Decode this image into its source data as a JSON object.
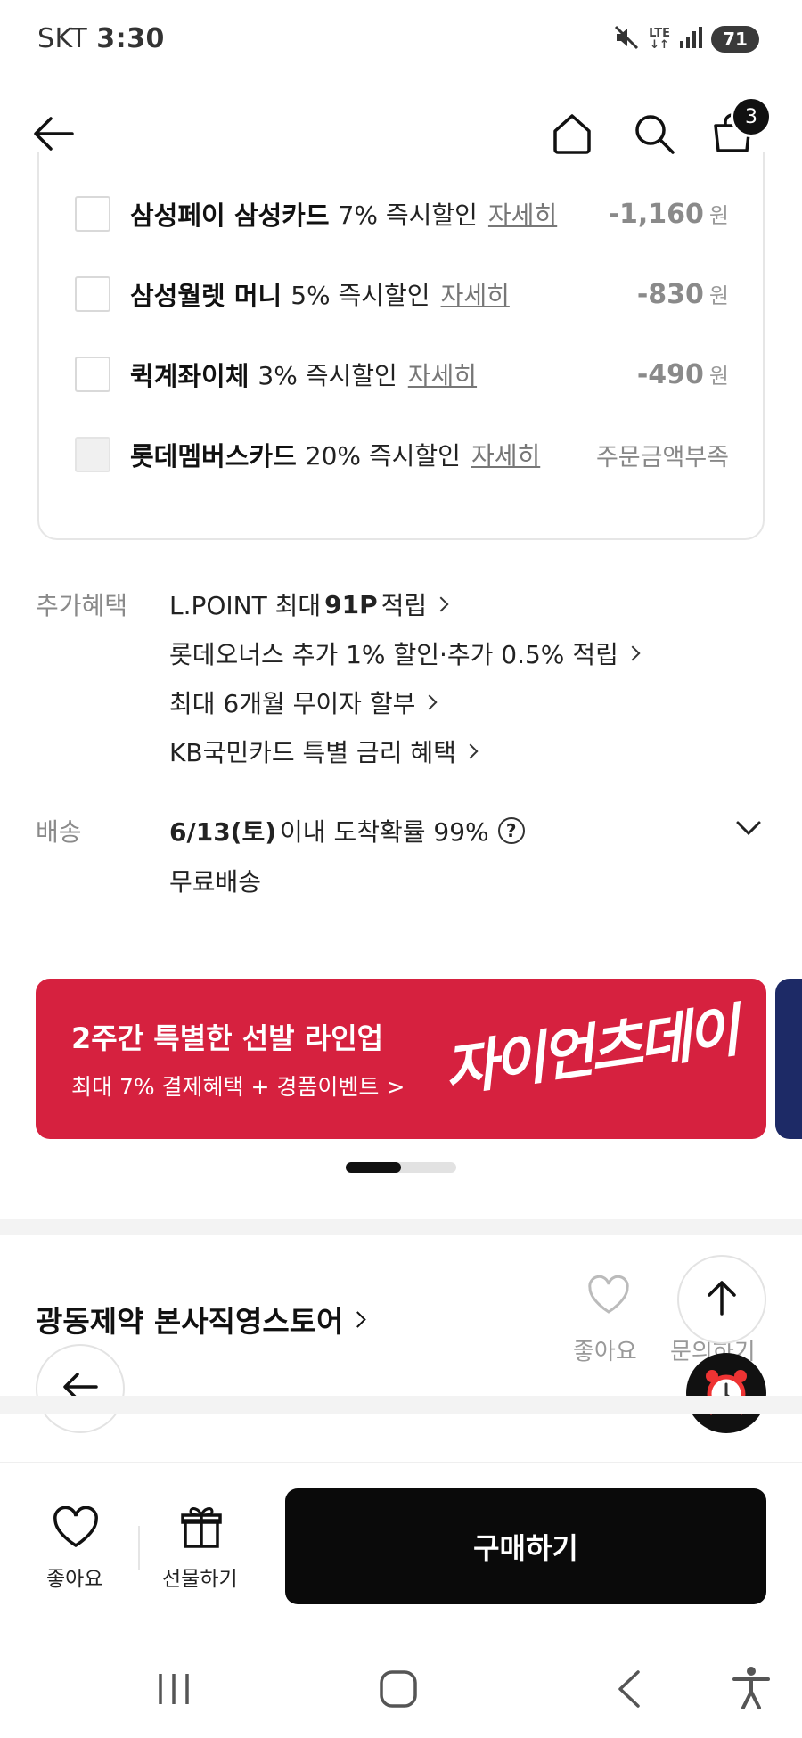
{
  "status_bar": {
    "carrier": "SKT",
    "time": "3:30",
    "network": "LTE",
    "battery": "71"
  },
  "header": {
    "cart_count": "3"
  },
  "payment_options": [
    {
      "name": "삼성페이 삼성카드",
      "desc": "7% 즉시할인",
      "link": "자세히",
      "amount": "-1,160",
      "unit": "원",
      "enabled": true
    },
    {
      "name": "삼성월렛 머니",
      "desc": "5% 즉시할인",
      "link": "자세히",
      "amount": "-830",
      "unit": "원",
      "enabled": true
    },
    {
      "name": "퀵계좌이체",
      "desc": "3% 즉시할인",
      "link": "자세히",
      "amount": "-490",
      "unit": "원",
      "enabled": true
    },
    {
      "name": "롯데멤버스카드",
      "desc": "20% 즉시할인",
      "link": "자세히",
      "note": "주문금액부족",
      "enabled": false
    }
  ],
  "benefits": {
    "label": "추가혜택",
    "items": [
      {
        "pre": "L.POINT 최대",
        "bold": "91P",
        "post": "적립"
      },
      {
        "pre": "롯데오너스 추가 1% 할인·추가 0.5% 적립",
        "bold": "",
        "post": ""
      },
      {
        "pre": "최대 6개월 무이자 할부",
        "bold": "",
        "post": ""
      },
      {
        "pre": "KB국민카드 특별 금리 혜택",
        "bold": "",
        "post": ""
      }
    ]
  },
  "delivery": {
    "label": "배송",
    "date": "6/13(토)",
    "text": "이내 도착확률 99%",
    "fee": "무료배송"
  },
  "banner": {
    "title": "2주간 특별한 선발 라인업",
    "subtitle": "최대 7% 결제혜택 + 경품이벤트 >",
    "logo_text": "자이언츠데이",
    "color": "#d6213f",
    "slide_progress": 0.5
  },
  "store": {
    "name": "광동제약 본사직영스토어",
    "like_label": "좋아요",
    "inquiry_label": "문의하기"
  },
  "bottom_bar": {
    "like_label": "좋아요",
    "gift_label": "선물하기",
    "buy_label": "구매하기"
  }
}
